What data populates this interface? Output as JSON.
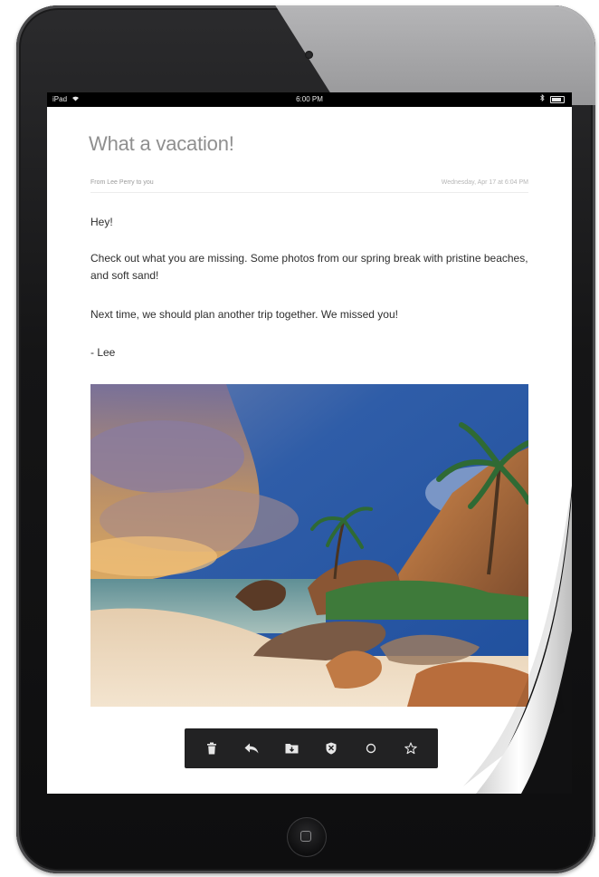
{
  "status_bar": {
    "carrier": "iPad",
    "time": "6:00 PM"
  },
  "email": {
    "subject": "What a vacation!",
    "from_line": "From Lee Perry to you",
    "date_line": "Wednesday, Apr 17 at 6:04 PM",
    "greeting": "Hey!",
    "paragraph_main": "Check out what you are missing. Some photos from our spring break with pristine beaches, and soft sand!",
    "paragraph_next": "Next time, we should plan another trip together. We missed you!",
    "signature": "- Lee"
  },
  "toolbar": {
    "actions": [
      {
        "name": "delete",
        "icon": "trash-icon"
      },
      {
        "name": "reply",
        "icon": "reply-icon"
      },
      {
        "name": "move-to-folder",
        "icon": "folder-icon"
      },
      {
        "name": "spam",
        "icon": "shield-icon"
      },
      {
        "name": "mark-unread",
        "icon": "circle-icon"
      },
      {
        "name": "flag",
        "icon": "star-icon"
      }
    ]
  },
  "colors": {
    "device_bezel": "#151516",
    "toolbar_bg": "#222223",
    "subject_text": "#8f8f8f",
    "body_text": "#2e2e2e"
  }
}
